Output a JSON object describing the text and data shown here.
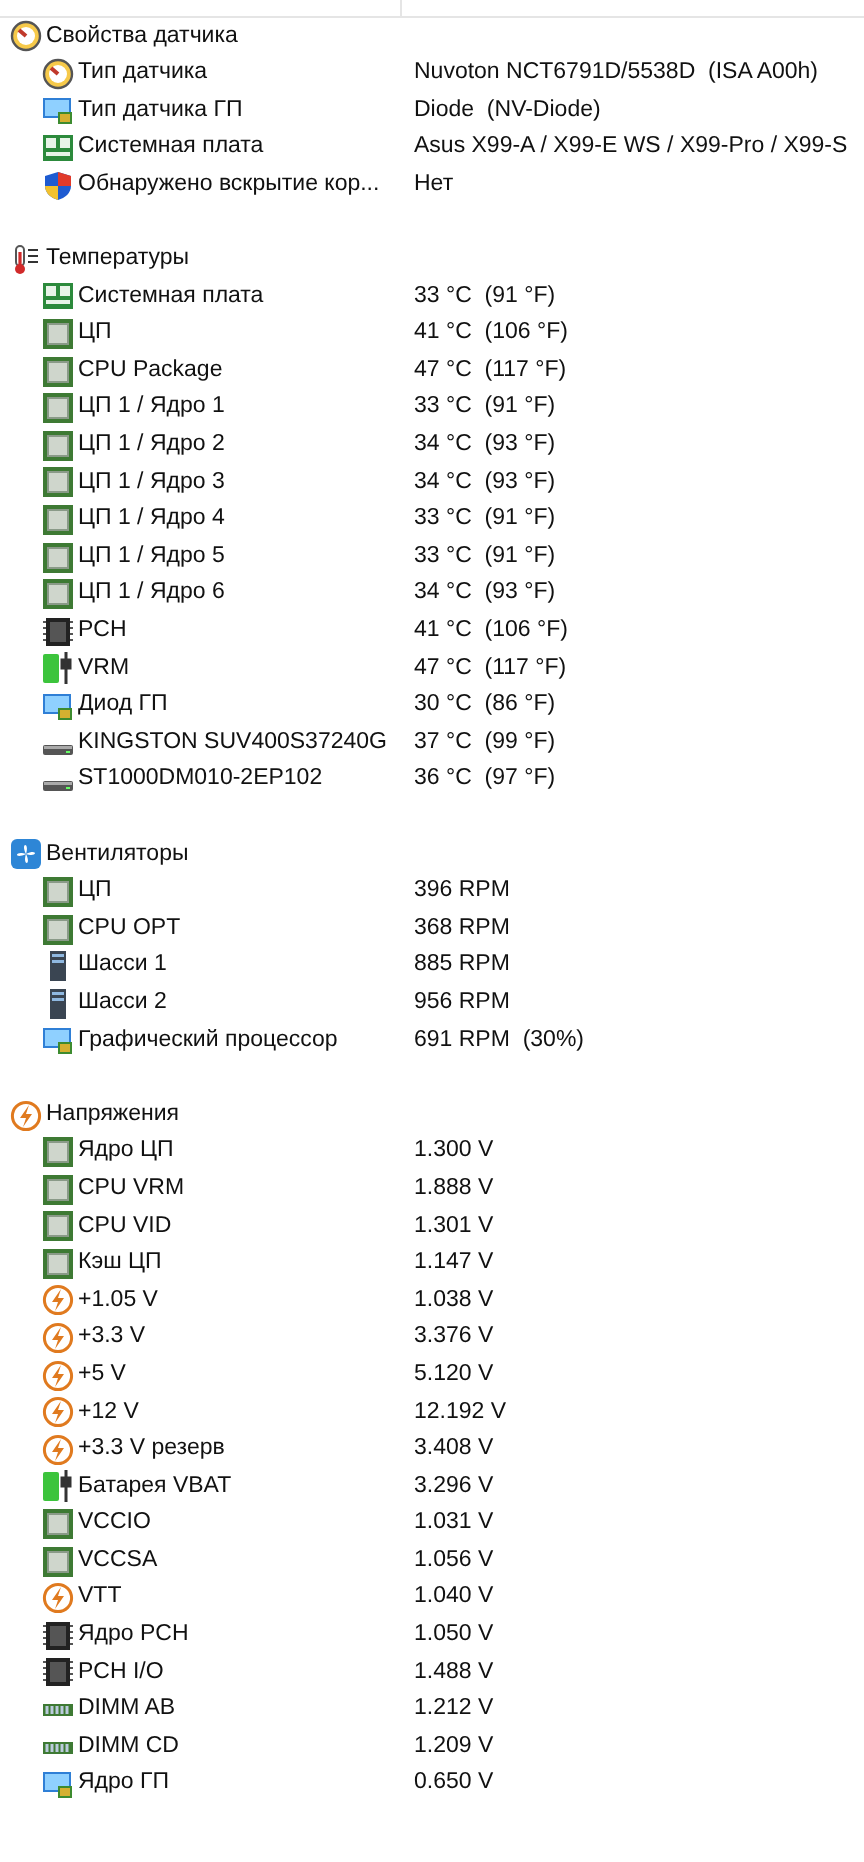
{
  "sections": [
    {
      "title": "Свойства датчика",
      "kind": "gauge",
      "items": [
        {
          "kind": "gauge",
          "label": "Тип датчика",
          "value": "Nuvoton NCT6791D/5538D  (ISA A00h)"
        },
        {
          "kind": "gpu",
          "label": "Тип датчика ГП",
          "value": "Diode  (NV-Diode)"
        },
        {
          "kind": "board",
          "label": "Системная плата",
          "value": "Asus X99-A / X99-E WS / X99-Pro / X99-S"
        },
        {
          "kind": "shield",
          "label": "Обнаружено вскрытие кор...",
          "value": "Нет"
        }
      ]
    },
    {
      "title": "Температуры",
      "kind": "thermometer",
      "items": [
        {
          "kind": "board",
          "label": "Системная плата",
          "value": "33 °C  (91 °F)"
        },
        {
          "kind": "chip",
          "label": "ЦП",
          "value": "41 °C  (106 °F)"
        },
        {
          "kind": "chip",
          "label": "CPU Package",
          "value": "47 °C  (117 °F)"
        },
        {
          "kind": "chip",
          "label": "ЦП 1 / Ядро 1",
          "value": "33 °C  (91 °F)"
        },
        {
          "kind": "chip",
          "label": "ЦП 1 / Ядро 2",
          "value": "34 °C  (93 °F)"
        },
        {
          "kind": "chip",
          "label": "ЦП 1 / Ядро 3",
          "value": "34 °C  (93 °F)"
        },
        {
          "kind": "chip",
          "label": "ЦП 1 / Ядро 4",
          "value": "33 °C  (91 °F)"
        },
        {
          "kind": "chip",
          "label": "ЦП 1 / Ядро 5",
          "value": "33 °C  (91 °F)"
        },
        {
          "kind": "chip",
          "label": "ЦП 1 / Ядро 6",
          "value": "34 °C  (93 °F)"
        },
        {
          "kind": "pch",
          "label": "PCH",
          "value": "41 °C  (106 °F)"
        },
        {
          "kind": "battery",
          "label": "VRM",
          "value": "47 °C  (117 °F)"
        },
        {
          "kind": "gpu",
          "label": "Диод ГП",
          "value": "30 °C  (86 °F)"
        },
        {
          "kind": "drive",
          "label": "KINGSTON SUV400S37240G",
          "value": "37 °C  (99 °F)"
        },
        {
          "kind": "drive",
          "label": "ST1000DM010-2EP102",
          "value": "36 °C  (97 °F)"
        }
      ]
    },
    {
      "title": "Вентиляторы",
      "kind": "fan",
      "items": [
        {
          "kind": "chip",
          "label": "ЦП",
          "value": "396 RPM"
        },
        {
          "kind": "chip",
          "label": "CPU OPT",
          "value": "368 RPM"
        },
        {
          "kind": "case",
          "label": "Шасси 1",
          "value": "885 RPM"
        },
        {
          "kind": "case",
          "label": "Шасси 2",
          "value": "956 RPM"
        },
        {
          "kind": "gpu",
          "label": "Графический процессор",
          "value": "691 RPM  (30%)"
        }
      ]
    },
    {
      "title": "Напряжения",
      "kind": "bolt",
      "items": [
        {
          "kind": "chip",
          "label": "Ядро ЦП",
          "value": "1.300 V"
        },
        {
          "kind": "chip",
          "label": "CPU VRM",
          "value": "1.888 V"
        },
        {
          "kind": "chip",
          "label": "CPU VID",
          "value": "1.301 V"
        },
        {
          "kind": "chip",
          "label": "Кэш ЦП",
          "value": "1.147 V"
        },
        {
          "kind": "bolt",
          "label": "+1.05 V",
          "value": "1.038 V"
        },
        {
          "kind": "bolt",
          "label": "+3.3 V",
          "value": "3.376 V"
        },
        {
          "kind": "bolt",
          "label": "+5 V",
          "value": "5.120 V"
        },
        {
          "kind": "bolt",
          "label": "+12 V",
          "value": "12.192 V"
        },
        {
          "kind": "bolt",
          "label": "+3.3 V резерв",
          "value": "3.408 V"
        },
        {
          "kind": "battery",
          "label": "Батарея VBAT",
          "value": "3.296 V"
        },
        {
          "kind": "chip",
          "label": "VCCIO",
          "value": "1.031 V"
        },
        {
          "kind": "chip",
          "label": "VCCSA",
          "value": "1.056 V"
        },
        {
          "kind": "bolt",
          "label": "VTT",
          "value": "1.040 V"
        },
        {
          "kind": "pch",
          "label": "Ядро PCH",
          "value": "1.050 V"
        },
        {
          "kind": "pch",
          "label": "PCH I/O",
          "value": "1.488 V"
        },
        {
          "kind": "ram",
          "label": "DIMM AB",
          "value": "1.212 V"
        },
        {
          "kind": "ram",
          "label": "DIMM CD",
          "value": "1.209 V"
        },
        {
          "kind": "gpu",
          "label": "Ядро ГП",
          "value": "0.650 V"
        }
      ]
    }
  ]
}
